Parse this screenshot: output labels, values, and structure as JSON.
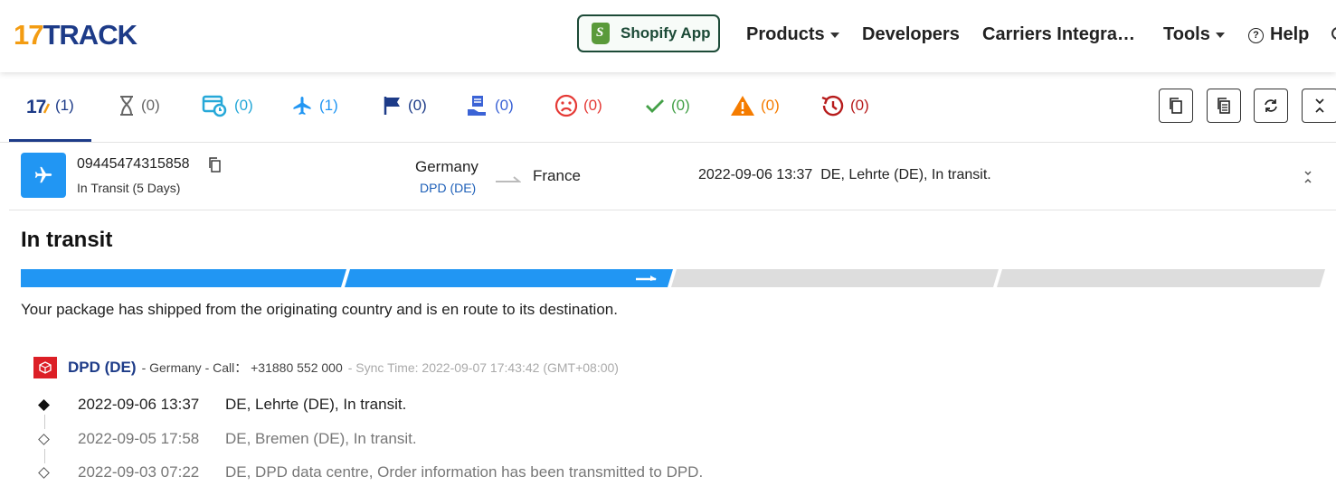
{
  "header": {
    "logo": {
      "number": "17",
      "text": "TRACK"
    },
    "shopify_label": "Shopify App",
    "nav": {
      "products": "Products",
      "developers": "Developers",
      "carriers": "Carriers Integra…",
      "tools": "Tools",
      "help": "Help"
    },
    "help_icon_glyph": "?"
  },
  "tabs": [
    {
      "name": "all",
      "count": "(1)",
      "color": "#1d3b88"
    },
    {
      "name": "not-found",
      "count": "(0)",
      "color": "#666666"
    },
    {
      "name": "info-received",
      "count": "(0)",
      "color": "#26a8d8"
    },
    {
      "name": "in-transit",
      "count": "(1)",
      "color": "#2196f3"
    },
    {
      "name": "pick-up",
      "count": "(0)",
      "color": "#1d3b88"
    },
    {
      "name": "out-for-delivery",
      "count": "(0)",
      "color": "#3b63d6"
    },
    {
      "name": "undelivered",
      "count": "(0)",
      "color": "#e53935"
    },
    {
      "name": "delivered",
      "count": "(0)",
      "color": "#43a047"
    },
    {
      "name": "alert",
      "count": "(0)",
      "color": "#f57c00"
    },
    {
      "name": "expired",
      "count": "(0)",
      "color": "#b71c1c"
    }
  ],
  "package": {
    "tracking_number": "09445474315858",
    "transit_status": "In Transit (5 Days)",
    "origin_country": "Germany",
    "origin_carrier": "DPD (DE)",
    "destination_country": "France",
    "last_event_time": "2022-09-06 13:37",
    "last_event_text": "DE, Lehrte (DE), In transit."
  },
  "detail": {
    "status_title": "In transit",
    "progress_stage": 2,
    "progress_total": 4,
    "status_description": "Your package has shipped from the originating country and is en route to its destination.",
    "carrier": {
      "name": "DPD (DE)",
      "country": "- Germany",
      "call": "- Call： +31880 552 000",
      "sync_time": "- Sync Time: 2022-09-07 17:43:42 (GMT+08:00)"
    },
    "events": [
      {
        "time": "2022-09-06 13:37",
        "text": "DE, Lehrte (DE), In transit.",
        "latest": true
      },
      {
        "time": "2022-09-05 17:58",
        "text": "DE, Bremen (DE), In transit.",
        "latest": false
      },
      {
        "time": "2022-09-03 07:22",
        "text": "DE, DPD data centre, Order information has been transmitted to DPD.",
        "latest": false
      }
    ]
  },
  "colors": {
    "brand_blue": "#1d3b88",
    "brand_orange": "#f39c12",
    "progress_active": "#2196f3",
    "progress_inactive": "#dddddd",
    "dpd_red": "#dc1f26"
  }
}
